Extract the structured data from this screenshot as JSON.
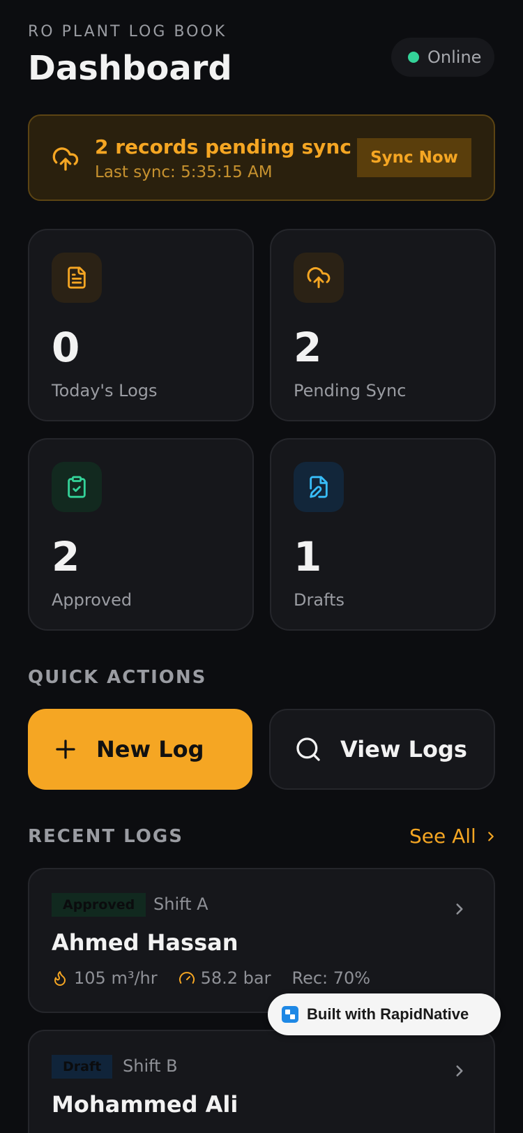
{
  "header": {
    "overline": "RO PLANT LOG BOOK",
    "title": "Dashboard",
    "status": "Online"
  },
  "sync_banner": {
    "title": "2 records pending sync",
    "subtitle": "Last sync: 5:35:15 AM",
    "button": "Sync Now",
    "icon": "cloud-upload-icon"
  },
  "stats": [
    {
      "value": "0",
      "label": "Today's Logs",
      "icon": "file-text-icon",
      "accent": "#f5a623"
    },
    {
      "value": "2",
      "label": "Pending Sync",
      "icon": "cloud-upload-icon",
      "accent": "#f5a623"
    },
    {
      "value": "2",
      "label": "Approved",
      "icon": "clipboard-check-icon",
      "accent": "#34d399"
    },
    {
      "value": "1",
      "label": "Drafts",
      "icon": "file-edit-icon",
      "accent": "#38bdf8"
    }
  ],
  "quick_actions": {
    "heading": "QUICK ACTIONS",
    "new_log": "New Log",
    "view_logs": "View Logs"
  },
  "recent_logs": {
    "heading": "RECENT LOGS",
    "see_all": "See All",
    "items": [
      {
        "status": "Approved",
        "shift": "Shift A",
        "name": "Ahmed Hassan",
        "flow": "105 m³/hr",
        "pressure": "58.2 bar",
        "recovery": "Rec: 70%"
      },
      {
        "status": "Draft",
        "shift": "Shift B",
        "name": "Mohammed Ali"
      }
    ]
  },
  "built_with": "Built with RapidNative",
  "colors": {
    "accent": "#f5a623",
    "online": "#34d399",
    "background": "#0c0d10",
    "card": "#16171b"
  }
}
